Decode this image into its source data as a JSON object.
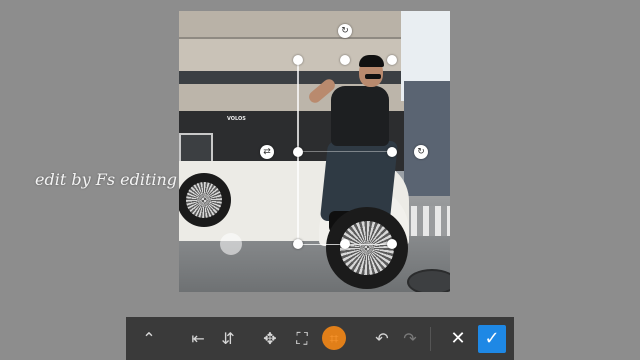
{
  "watermark": {
    "text": "edit by Fs editing"
  },
  "photo": {
    "sign_text": "VOLOS"
  },
  "toolbar": {
    "buttons": [
      {
        "icon": "chevron-up-icon",
        "glyph": "⌃"
      },
      {
        "icon": "flip-horizontal-icon",
        "glyph": "⇤"
      },
      {
        "icon": "flip-vertical-icon",
        "glyph": "⇵"
      },
      {
        "icon": "move-icon",
        "glyph": "✥"
      },
      {
        "icon": "transform-icon",
        "glyph": "⛶"
      },
      {
        "icon": "crop-icon",
        "glyph": "⌗"
      },
      {
        "icon": "undo-icon",
        "glyph": "↶"
      },
      {
        "icon": "redo-icon",
        "glyph": "↷"
      },
      {
        "icon": "close-icon",
        "glyph": "✕"
      },
      {
        "icon": "confirm-icon",
        "glyph": "✓"
      }
    ]
  },
  "colors": {
    "confirm": "#1e88e5",
    "tap_indicator": "#ff8c14",
    "toolbar_bg": "#3a3a3a",
    "background": "#8d8d8d"
  }
}
